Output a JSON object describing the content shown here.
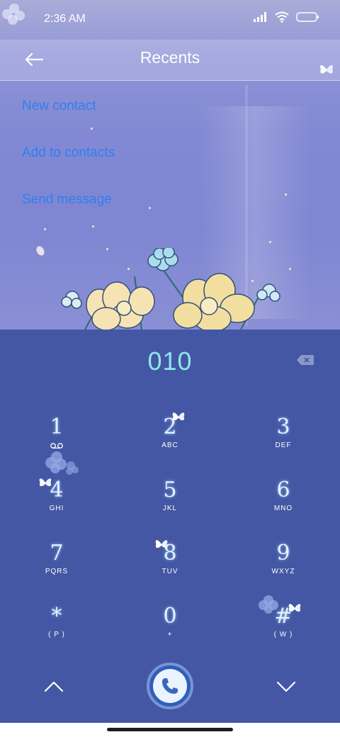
{
  "status": {
    "time": "2:36 AM"
  },
  "header": {
    "title": "Recents"
  },
  "actions": [
    {
      "label": "New contact"
    },
    {
      "label": "Add to contacts"
    },
    {
      "label": "Send message"
    }
  ],
  "dialer": {
    "number": "010",
    "keys": [
      {
        "digit": "1",
        "letters": ""
      },
      {
        "digit": "2",
        "letters": "ABC"
      },
      {
        "digit": "3",
        "letters": "DEF"
      },
      {
        "digit": "4",
        "letters": "GHI"
      },
      {
        "digit": "5",
        "letters": "JKL"
      },
      {
        "digit": "6",
        "letters": "MNO"
      },
      {
        "digit": "7",
        "letters": "PQRS"
      },
      {
        "digit": "8",
        "letters": "TUV"
      },
      {
        "digit": "9",
        "letters": "WXYZ"
      },
      {
        "digit": "*",
        "letters": "( P )"
      },
      {
        "digit": "0",
        "letters": "+"
      },
      {
        "digit": "#",
        "letters": "( W )"
      }
    ]
  },
  "icons": {
    "back": "back-arrow-icon",
    "delete": "backspace-icon",
    "voicemail": "voicemail-icon",
    "call": "phone-icon",
    "up": "chevron-up-icon",
    "down": "chevron-down-icon"
  },
  "colors": {
    "action_text": "#2f7ff0",
    "keypad_bg": "#4457a4",
    "number_text": "#8fe6ea"
  }
}
